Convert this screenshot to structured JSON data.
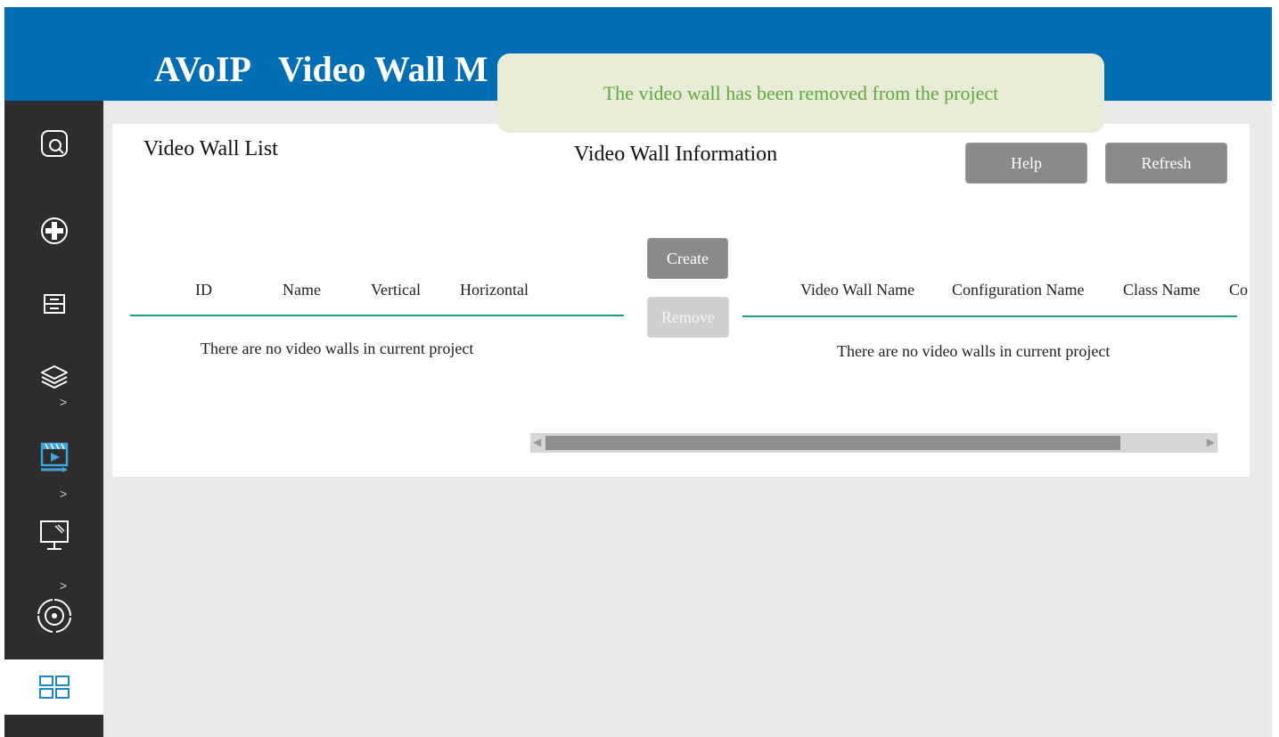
{
  "header": {
    "title_part1": "AVoIP",
    "title_part2": "Video Wall M"
  },
  "toast": {
    "message": "The video wall has been removed from the project"
  },
  "sidebar": {
    "items": [
      {
        "icon": "search-icon"
      },
      {
        "icon": "add-circle-icon"
      },
      {
        "icon": "server-icon"
      },
      {
        "icon": "layers-icon",
        "chevron": ">"
      },
      {
        "icon": "video-play-icon",
        "chevron": ">"
      },
      {
        "icon": "monitor-icon",
        "chevron": ">"
      },
      {
        "icon": "target-icon",
        "chevron": ">"
      },
      {
        "icon": "video-wall-grid-icon"
      }
    ]
  },
  "list": {
    "title": "Video Wall List",
    "columns": [
      "ID",
      "Name",
      "Vertical",
      "Horizontal"
    ],
    "empty_message": "There are no video walls in current project"
  },
  "info": {
    "title": "Video Wall Information",
    "columns": [
      "Video Wall Name",
      "Configuration Name",
      "Class Name",
      "Co"
    ],
    "empty_message": "There are no video walls in current project"
  },
  "buttons": {
    "help": "Help",
    "refresh": "Refresh",
    "create": "Create",
    "remove": "Remove"
  },
  "colors": {
    "header": "#016db3",
    "accent_rule": "#1d9b8a",
    "toast_text": "#62a83a",
    "sidebar": "#2d2d2d"
  }
}
